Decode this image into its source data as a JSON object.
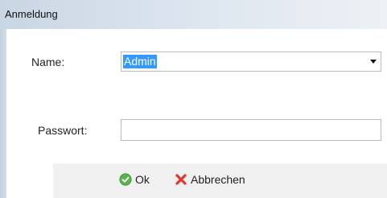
{
  "window": {
    "title": "Anmeldung"
  },
  "form": {
    "name_label": "Name:",
    "name_value": "Admin",
    "password_label": "Passwort:",
    "password_value": ""
  },
  "buttons": {
    "ok_label": "Ok",
    "cancel_label": "Abbrechen"
  },
  "icons": {
    "ok": "green-checkmark-circle-icon",
    "cancel": "red-x-icon",
    "dropdown": "chevron-down-icon"
  },
  "colors": {
    "selection": "#3399ff",
    "ok_green": "#58b44a",
    "cancel_red": "#e0392b"
  }
}
